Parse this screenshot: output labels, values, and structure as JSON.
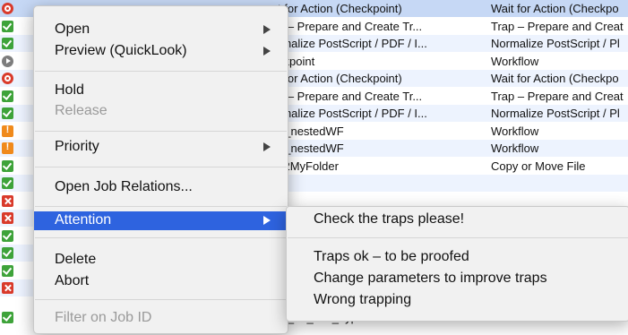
{
  "jobs": [
    {
      "status": "stop-icon",
      "col_a": "t for Action (Checkpoint)",
      "col_b": "Wait for Action (Checkpo"
    },
    {
      "status": "ok-icon",
      "col_a": "p – Prepare and Create Tr...",
      "col_b": "Trap – Prepare and Creat"
    },
    {
      "status": "ok-icon",
      "col_a": "rmalize PostScript / PDF / I...",
      "col_b": "Normalize PostScript / Pl"
    },
    {
      "status": "held-icon",
      "col_a": "ckpoint",
      "col_b": "Workflow"
    },
    {
      "status": "stop-icon",
      "col_a": "t for Action (Checkpoint)",
      "col_b": "Wait for Action (Checkpo"
    },
    {
      "status": "ok-icon",
      "col_a": "p – Prepare and Create Tr...",
      "col_b": "Trap – Prepare and Creat"
    },
    {
      "status": "ok-icon",
      "col_a": "rmalize PostScript / PDF / I...",
      "col_b": "Normalize PostScript / Pl"
    },
    {
      "status": "warn-icon",
      "col_a": "p_nestedWF",
      "col_b": "Workflow"
    },
    {
      "status": "warn-icon",
      "col_a": "p_nestedWF",
      "col_b": "Workflow"
    },
    {
      "status": "ok-icon",
      "col_a": "y2MyFolder",
      "col_b": "Copy or Move File"
    },
    {
      "status": "ok-icon",
      "col_a": "",
      "col_b": ""
    },
    {
      "status": "error-icon",
      "col_a": "",
      "col_b": ""
    },
    {
      "status": "error-icon",
      "col_a": "",
      "col_b": ""
    },
    {
      "status": "ok-icon",
      "col_a": "",
      "col_b": ""
    },
    {
      "status": "ok-icon",
      "col_a": "",
      "col_b": ""
    },
    {
      "status": "ok-icon",
      "col_a": "",
      "col_b": ""
    },
    {
      "status": "error-icon",
      "col_a": "",
      "col_b": ""
    },
    {
      "status": "ok-icon",
      "col_a": "te_on_File_Type",
      "col_b": "Workflow"
    }
  ],
  "context_menu": {
    "open": "Open",
    "preview": "Preview (QuickLook)",
    "hold": "Hold",
    "release": "Release",
    "priority": "Priority",
    "open_relations": "Open Job Relations...",
    "attention": "Attention",
    "delete": "Delete",
    "abort": "Abort",
    "filter": "Filter on Job ID"
  },
  "attention_submenu": {
    "items": [
      "Check the traps please!",
      "Traps ok – to be proofed",
      "Change parameters to improve traps",
      "Wrong trapping"
    ]
  },
  "colors": {
    "highlight": "#2e63df",
    "selected_row": "#c6d8f5",
    "alt_row": "#edf3fe"
  }
}
